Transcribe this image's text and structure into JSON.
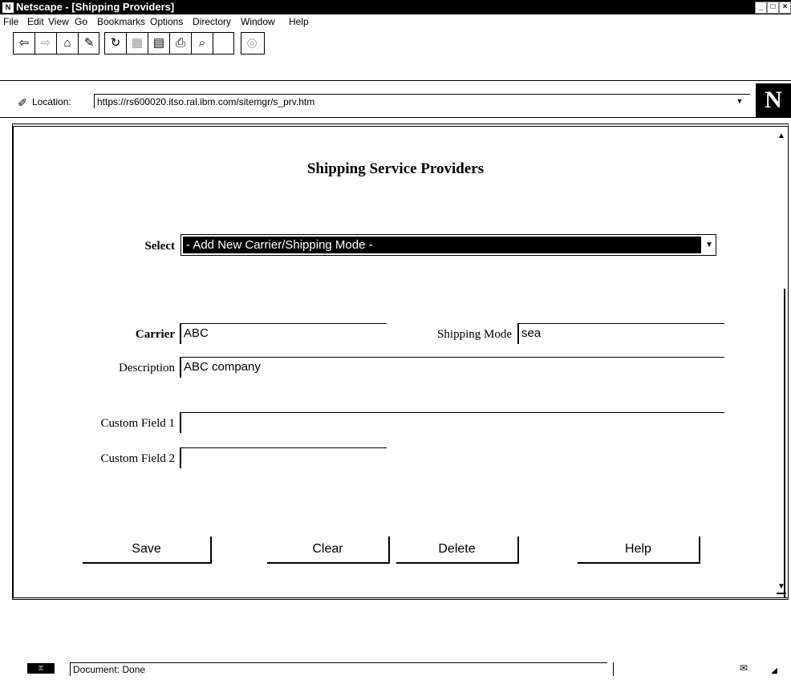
{
  "window": {
    "title": "Netscape - [Shipping Providers]",
    "controls": [
      "minimize-icon",
      "maximize-icon",
      "close-icon"
    ]
  },
  "menu": {
    "items": [
      "File",
      "Edit",
      "View",
      "Go",
      "Bookmarks",
      "Options",
      "Directory",
      "Window",
      "Help"
    ]
  },
  "toolbar": {
    "icons": [
      "back-icon",
      "forward-icon",
      "home-icon",
      "edit-icon",
      "reload-icon",
      "images-icon",
      "open-icon",
      "print-icon",
      "find-icon",
      "stop-icon"
    ]
  },
  "location": {
    "label": "Location:",
    "url": "https://rs600020.itso.ral.ibm.com/sitemgr/s_prv.htm"
  },
  "page": {
    "title": "Shipping Service Providers",
    "select_label": "Select",
    "select_value": "- Add New Carrier/Shipping Mode -",
    "carrier_label": "Carrier",
    "carrier_value": "ABC",
    "shipping_mode_label": "Shipping Mode",
    "shipping_mode_value": "sea",
    "description_label": "Description",
    "description_value": "ABC company",
    "custom1_label": "Custom Field 1",
    "custom1_value": "",
    "custom2_label": "Custom Field 2",
    "custom2_value": "",
    "buttons": {
      "save": "Save",
      "clear": "Clear",
      "delete": "Delete",
      "help": "Help"
    }
  },
  "status": {
    "text": "Document: Done"
  }
}
